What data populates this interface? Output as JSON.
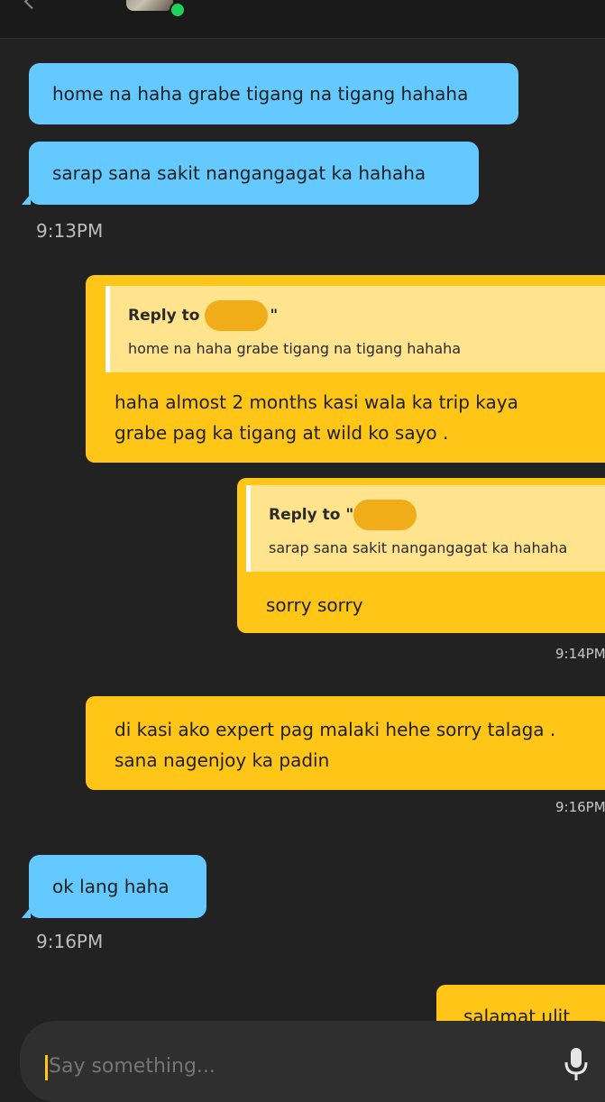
{
  "messages": [
    {
      "text": "home na haha grabe tigang na tigang hahaha"
    },
    {
      "text": "sarap sana sakit nangangagat ka hahaha"
    },
    {
      "time": "9:13PM"
    },
    {
      "reply_prefix": "Reply to",
      "reply_suffix": "\"",
      "quoted": "home na haha grabe tigang na tigang hahaha",
      "line1": "haha almost 2 months kasi wala ka trip kaya",
      "line2": "grabe pag ka tigang at wild ko sayo ."
    },
    {
      "reply_prefix": "Reply to \"",
      "quoted": "sarap sana sakit nangangagat ka hahaha",
      "text": "sorry sorry"
    },
    {
      "time": "9:14PM"
    },
    {
      "line1": "di kasi ako expert pag malaki hehe sorry talaga .",
      "line2": "sana nagenjoy ka padin"
    },
    {
      "time": "9:16PM"
    },
    {
      "text": "ok lang haha"
    },
    {
      "time": "9:16PM"
    },
    {
      "text": "salamat ulit"
    }
  ],
  "composer": {
    "placeholder": "Say something..."
  },
  "colors": {
    "incoming": "#63c9ff",
    "outgoing": "#ffc617",
    "quote": "#ffe38d",
    "background": "#222222",
    "online": "#1fd15b"
  },
  "icons": {
    "mic": "microphone-icon",
    "status": "online-dot-icon",
    "back": "back-arrow-icon"
  }
}
